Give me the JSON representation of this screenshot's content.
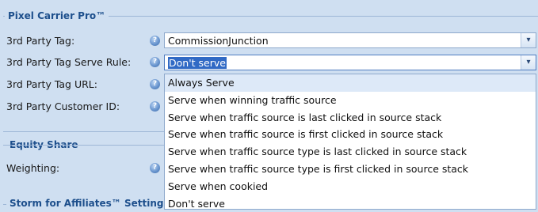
{
  "sections": {
    "pixel_carrier": "Pixel Carrier Pro™",
    "equity_share": "Equity Share",
    "storm": "Storm for Affiliates™ Settings"
  },
  "fields": {
    "tag_label": "3rd Party Tag:",
    "serve_rule_label": "3rd Party Tag Serve Rule:",
    "tag_url_label": "3rd Party Tag URL:",
    "customer_id_label": "3rd Party Customer ID:",
    "weighting_label": "Weighting:"
  },
  "tag_select": {
    "value": "CommissionJunction"
  },
  "serve_rule_select": {
    "value": "Don't serve"
  },
  "help_glyph": "?",
  "arrow_glyph": "▾",
  "serve_rule_options": [
    "Always Serve",
    "Serve when winning traffic source",
    "Serve when traffic source is last clicked in source stack",
    "Serve when traffic source is first clicked in source stack",
    "Serve when traffic source type is last clicked in source stack",
    "Serve when traffic source type is first clicked in source stack",
    "Serve when cookied",
    "Don't serve"
  ]
}
